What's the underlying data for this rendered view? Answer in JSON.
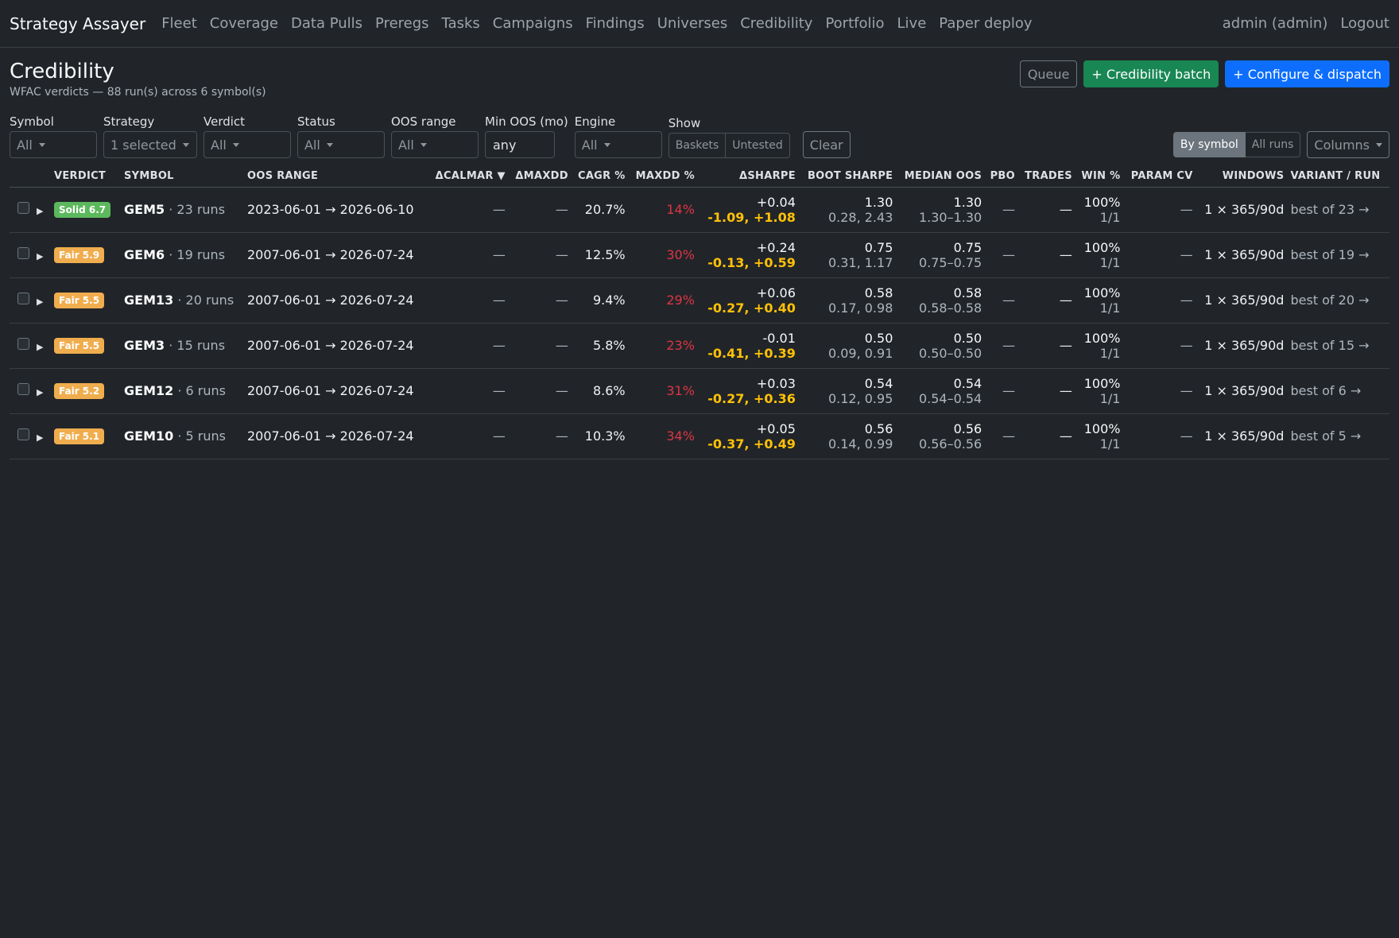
{
  "nav": {
    "brand": "Strategy Assayer",
    "links": [
      "Fleet",
      "Coverage",
      "Data Pulls",
      "Preregs",
      "Tasks",
      "Campaigns",
      "Findings",
      "Universes",
      "Credibility",
      "Portfolio",
      "Live",
      "Paper deploy"
    ],
    "user": "admin (admin)",
    "logout": "Logout"
  },
  "header": {
    "title": "Credibility",
    "subtitle": "WFAC verdicts — 88 run(s) across 6 symbol(s)",
    "queue_label": "Queue",
    "batch_label": "+ Credibility batch",
    "dispatch_label": "+ Configure & dispatch"
  },
  "filters": {
    "symbol": {
      "label": "Symbol",
      "value": "All"
    },
    "strategy": {
      "label": "Strategy",
      "value": "1 selected"
    },
    "verdict": {
      "label": "Verdict",
      "value": "All"
    },
    "status": {
      "label": "Status",
      "value": "All"
    },
    "oos_range": {
      "label": "OOS range",
      "value": "All"
    },
    "min_oos": {
      "label": "Min OOS (mo)",
      "value": "any"
    },
    "engine": {
      "label": "Engine",
      "value": "All"
    },
    "show": {
      "label": "Show",
      "baskets": "Baskets",
      "untested": "Untested"
    },
    "clear": "Clear",
    "view": {
      "by_symbol": "By symbol",
      "all_runs": "All runs"
    },
    "columns": "Columns"
  },
  "colors": {
    "solid": "#5cb85c",
    "fair": "#f0ad4e",
    "red": "#dc3545",
    "yellow": "#ffc107"
  },
  "table": {
    "headers": {
      "verdict": "Verdict",
      "symbol": "Symbol",
      "oos_range": "OOS range",
      "dcalmar": "ΔCalmar ▼",
      "dmaxdd": "ΔMaxDD",
      "cagr": "CAGR %",
      "maxdd": "MaxDD %",
      "dsharpe": "ΔSharpe",
      "boot_sharpe": "Boot Sharpe",
      "median_oos": "Median OOS",
      "pbo": "PBO",
      "trades": "Trades",
      "win": "Win %",
      "param_cv": "Param CV",
      "windows": "Windows",
      "variant": "Variant / run"
    },
    "rows": [
      {
        "verdict": "Solid 6.7",
        "tone": "solid",
        "symbol": "GEM5",
        "runs": "· 23 runs",
        "oos": "2023-06-01 → 2026-06-10",
        "dcalmar": "—",
        "dmaxdd": "—",
        "cagr": "20.7%",
        "maxdd": "14%",
        "dsharpe": "+0.04",
        "dsharpe_ci": "-1.09, +1.08",
        "boot": "1.30",
        "boot_ci": "0.28, 2.43",
        "median": "1.30",
        "median_range": "1.30–1.30",
        "pbo": "—",
        "trades": "—",
        "win": "100%",
        "win_frac": "1/1",
        "param_cv": "—",
        "windows": "1 × 365/90d",
        "variant": "best of 23 →"
      },
      {
        "verdict": "Fair 5.9",
        "tone": "fair",
        "symbol": "GEM6",
        "runs": "· 19 runs",
        "oos": "2007-06-01 → 2026-07-24",
        "dcalmar": "—",
        "dmaxdd": "—",
        "cagr": "12.5%",
        "maxdd": "30%",
        "dsharpe": "+0.24",
        "dsharpe_ci": "-0.13, +0.59",
        "boot": "0.75",
        "boot_ci": "0.31, 1.17",
        "median": "0.75",
        "median_range": "0.75–0.75",
        "pbo": "—",
        "trades": "—",
        "win": "100%",
        "win_frac": "1/1",
        "param_cv": "—",
        "windows": "1 × 365/90d",
        "variant": "best of 19 →"
      },
      {
        "verdict": "Fair 5.5",
        "tone": "fair",
        "symbol": "GEM13",
        "runs": "· 20 runs",
        "oos": "2007-06-01 → 2026-07-24",
        "dcalmar": "—",
        "dmaxdd": "—",
        "cagr": "9.4%",
        "maxdd": "29%",
        "dsharpe": "+0.06",
        "dsharpe_ci": "-0.27, +0.40",
        "boot": "0.58",
        "boot_ci": "0.17, 0.98",
        "median": "0.58",
        "median_range": "0.58–0.58",
        "pbo": "—",
        "trades": "—",
        "win": "100%",
        "win_frac": "1/1",
        "param_cv": "—",
        "windows": "1 × 365/90d",
        "variant": "best of 20 →"
      },
      {
        "verdict": "Fair 5.5",
        "tone": "fair",
        "symbol": "GEM3",
        "runs": "· 15 runs",
        "oos": "2007-06-01 → 2026-07-24",
        "dcalmar": "—",
        "dmaxdd": "—",
        "cagr": "5.8%",
        "maxdd": "23%",
        "dsharpe": "-0.01",
        "dsharpe_ci": "-0.41, +0.39",
        "boot": "0.50",
        "boot_ci": "0.09, 0.91",
        "median": "0.50",
        "median_range": "0.50–0.50",
        "pbo": "—",
        "trades": "—",
        "win": "100%",
        "win_frac": "1/1",
        "param_cv": "—",
        "windows": "1 × 365/90d",
        "variant": "best of 15 →"
      },
      {
        "verdict": "Fair 5.2",
        "tone": "fair",
        "symbol": "GEM12",
        "runs": "· 6 runs",
        "oos": "2007-06-01 → 2026-07-24",
        "dcalmar": "—",
        "dmaxdd": "—",
        "cagr": "8.6%",
        "maxdd": "31%",
        "dsharpe": "+0.03",
        "dsharpe_ci": "-0.27, +0.36",
        "boot": "0.54",
        "boot_ci": "0.12, 0.95",
        "median": "0.54",
        "median_range": "0.54–0.54",
        "pbo": "—",
        "trades": "—",
        "win": "100%",
        "win_frac": "1/1",
        "param_cv": "—",
        "windows": "1 × 365/90d",
        "variant": "best of 6 →"
      },
      {
        "verdict": "Fair 5.1",
        "tone": "fair",
        "symbol": "GEM10",
        "runs": "· 5 runs",
        "oos": "2007-06-01 → 2026-07-24",
        "dcalmar": "—",
        "dmaxdd": "—",
        "cagr": "10.3%",
        "maxdd": "34%",
        "dsharpe": "+0.05",
        "dsharpe_ci": "-0.37, +0.49",
        "boot": "0.56",
        "boot_ci": "0.14, 0.99",
        "median": "0.56",
        "median_range": "0.56–0.56",
        "pbo": "—",
        "trades": "—",
        "win": "100%",
        "win_frac": "1/1",
        "param_cv": "—",
        "windows": "1 × 365/90d",
        "variant": "best of 5 →"
      }
    ]
  }
}
